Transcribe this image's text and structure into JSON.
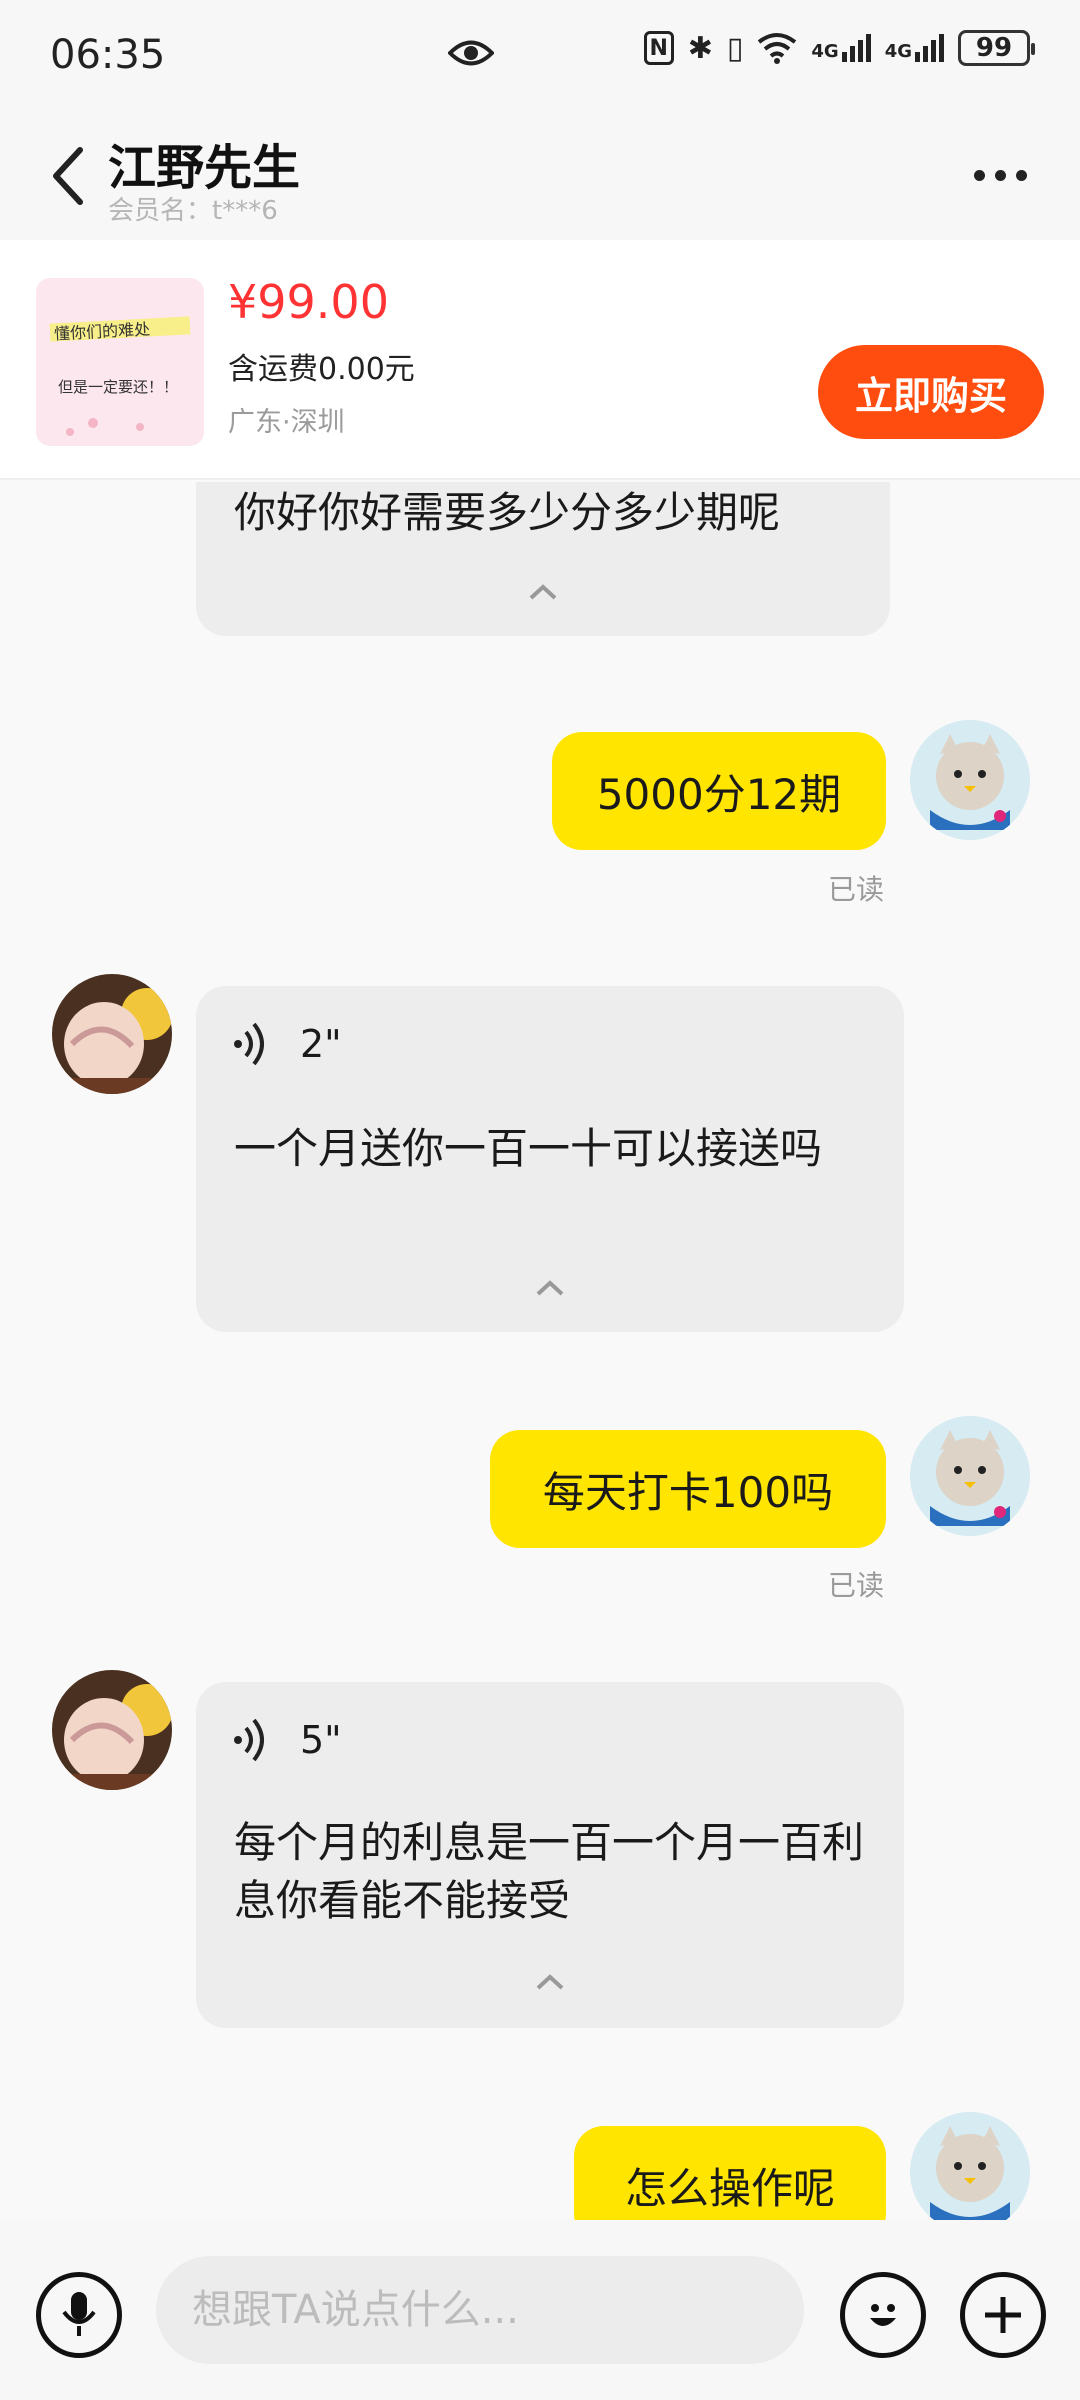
{
  "status_bar": {
    "time": "06:35",
    "nfc": "N",
    "bluetooth": "✱",
    "vibrate": "▯",
    "signal_1": "4G",
    "signal_2": "4G",
    "battery": "99"
  },
  "header": {
    "title": "江野先生",
    "member_label": "会员名：t***6"
  },
  "product": {
    "thumb_line1": "懂你们的难处",
    "thumb_line2": "但是一定要还！！",
    "price": "¥99.00",
    "shipping": "含运费0.00元",
    "location": "广东·深圳",
    "buy_label": "立即购买"
  },
  "messages": [
    {
      "side": "left",
      "text": "你好你好需要多少分多少期呢"
    },
    {
      "side": "right",
      "text": "5000分12期",
      "status": "已读"
    },
    {
      "side": "left",
      "voice_duration": "2\"",
      "text": "一个月送你一百一十可以接送吗"
    },
    {
      "side": "right",
      "text": "每天打卡100吗",
      "status": "已读"
    },
    {
      "side": "left",
      "voice_duration": "5\"",
      "text": "每个月的利息是一百一个月一百利息你看能不能接受"
    },
    {
      "side": "right",
      "text": "怎么操作呢"
    }
  ],
  "input": {
    "placeholder": "想跟TA说点什么..."
  }
}
